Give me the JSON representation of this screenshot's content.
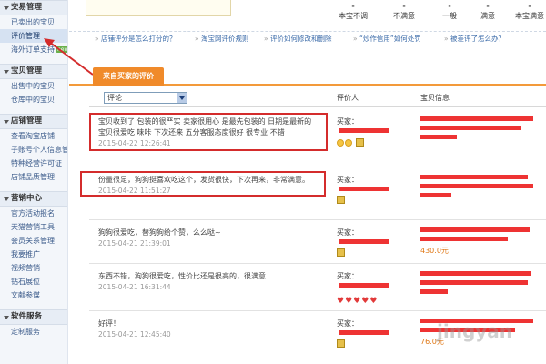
{
  "sidebar": {
    "sections": [
      {
        "title": "交易管理",
        "items": [
          {
            "label": "已卖出的宝贝",
            "active": false,
            "badge": ""
          },
          {
            "label": "评价管理",
            "active": true,
            "badge": ""
          },
          {
            "label": "海外订单支持",
            "active": false,
            "badge": "new"
          }
        ]
      },
      {
        "title": "宝贝管理",
        "items": [
          {
            "label": "出售中的宝贝",
            "active": false,
            "badge": ""
          },
          {
            "label": "仓库中的宝贝",
            "active": false,
            "badge": ""
          }
        ]
      },
      {
        "title": "店铺管理",
        "items": [
          {
            "label": "查看淘宝店铺",
            "active": false,
            "badge": ""
          },
          {
            "label": "子账号个人信息管理",
            "active": false,
            "badge": ""
          },
          {
            "label": "特种经营许可证",
            "active": false,
            "badge": ""
          },
          {
            "label": "店铺品质管理",
            "active": false,
            "badge": ""
          }
        ]
      },
      {
        "title": "营销中心",
        "items": [
          {
            "label": "官方活动报名",
            "active": false,
            "badge": ""
          },
          {
            "label": "天猫营销工具",
            "active": false,
            "badge": ""
          },
          {
            "label": "会员关系管理",
            "active": false,
            "badge": ""
          },
          {
            "label": "我要推广",
            "active": false,
            "badge": ""
          },
          {
            "label": "视频营销",
            "active": false,
            "badge": ""
          },
          {
            "label": "钻石展位",
            "active": false,
            "badge": ""
          },
          {
            "label": "文献参谋",
            "active": false,
            "badge": ""
          }
        ]
      },
      {
        "title": "软件服务",
        "items": [
          {
            "label": "定制服务",
            "active": false,
            "badge": ""
          }
        ]
      }
    ]
  },
  "stats": [
    {
      "label": "本宝不调"
    },
    {
      "label": "不满意"
    },
    {
      "label": "一般"
    },
    {
      "label": "满意"
    },
    {
      "label": "本宝满意"
    }
  ],
  "help_links": [
    "店铺评分是怎么打分的？",
    "淘宝网评价规则",
    "评价如何修改和删除",
    "“炒作信用”如何处罚",
    "被差评了怎么办？"
  ],
  "tab_label": "来自买家的评价",
  "filter": {
    "selected": "评论"
  },
  "columns": {
    "rater": "评价人",
    "item": "宝贝信息"
  },
  "buyer_label": "买家：",
  "reviews": [
    {
      "text": "宝贝收到了 包装的很严实 卖家很用心 是最先包装的 日期是最新的 宝贝很爱吃 味咔 下次还来 五分客服态度很好 很专业 不错",
      "time": "2015-04-22 12:26:41",
      "icons": "medals",
      "price": "",
      "highlighted": true
    },
    {
      "text": "份量很足，狗狗挺喜欢吃这个，发货很快，下次再来，非常满意。",
      "time": "2015-04-22 11:51:27",
      "icons": "approve",
      "price": "",
      "highlighted": true
    },
    {
      "text": "狗狗很爱吃，替狗狗给个赞，么么哒~",
      "time": "2015-04-21 21:39:01",
      "icons": "approve",
      "price": "430.0元",
      "highlighted": false
    },
    {
      "text": "东西不错，狗狗很爱吃，性价比还是很高的，很满意",
      "time": "2015-04-21 16:31:44",
      "icons": "hearts",
      "price": "",
      "highlighted": false
    },
    {
      "text": "好评！",
      "time": "2015-04-21 12:45:40",
      "icons": "approve",
      "price": "76.0元",
      "highlighted": false
    }
  ],
  "watermark": "jingyan"
}
